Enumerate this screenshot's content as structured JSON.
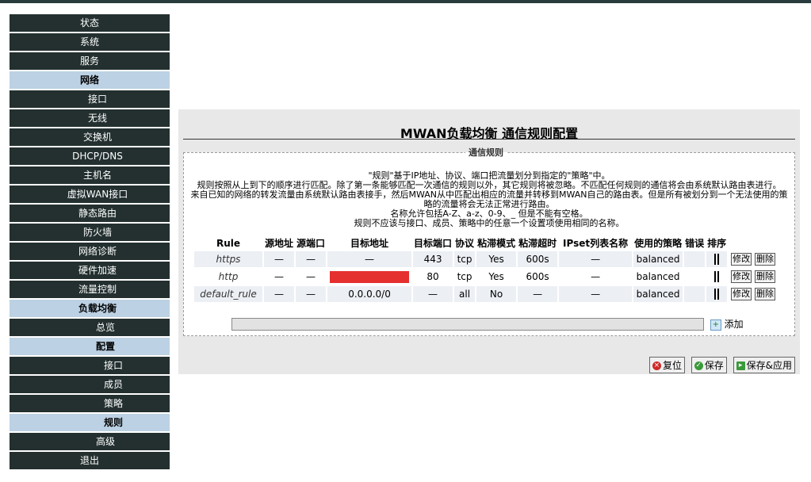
{
  "sidebar": {
    "items": [
      {
        "label": "状态"
      },
      {
        "label": "系统"
      },
      {
        "label": "服务"
      },
      {
        "label": "网络"
      },
      {
        "label": "接口"
      },
      {
        "label": "无线"
      },
      {
        "label": "交换机"
      },
      {
        "label": "DHCP/DNS"
      },
      {
        "label": "主机名"
      },
      {
        "label": "虚拟WAN接口"
      },
      {
        "label": "静态路由"
      },
      {
        "label": "防火墙"
      },
      {
        "label": "网络诊断"
      },
      {
        "label": "硬件加速"
      },
      {
        "label": "流量控制"
      },
      {
        "label": "负载均衡"
      },
      {
        "label": "总览"
      },
      {
        "label": "配置"
      },
      {
        "label": "接口"
      },
      {
        "label": "成员"
      },
      {
        "label": "策略"
      },
      {
        "label": "规则"
      },
      {
        "label": "高级"
      },
      {
        "label": "退出"
      }
    ]
  },
  "page": {
    "title": "MWAN负载均衡 通信规则配置",
    "section_legend": "通信规则",
    "description": [
      "\"规则\"基于IP地址、协议、端口把流量划分到指定的\"策略\"中。",
      "规则按照从上到下的顺序进行匹配。除了第一条能够匹配一次通信的规则以外，其它规则将被忽略。不匹配任何规则的通信将会由系统默认路由表进行。",
      "来自已知的网络的转发流量由系统默认路由表接手，然后MWAN从中匹配出相应的流量并转移到MWAN自己的路由表。但是所有被划分到一个无法使用的策略的流量将会无法正常进行路由。",
      "名称允许包括A-Z、a-z、0-9、_ 但是不能有空格。",
      "规则不应该与接口、成员、策略中的任意一个设置项使用相同的名称。"
    ]
  },
  "table": {
    "headers": [
      "Rule",
      "源地址",
      "源端口",
      "目标地址",
      "目标端口",
      "协议",
      "粘滞模式",
      "粘滞超时",
      "IPset列表名称",
      "使用的策略",
      "错误",
      "排序"
    ],
    "rows": [
      {
        "rule": "https",
        "src": "—",
        "sport": "—",
        "dest": "—",
        "dport": "443",
        "proto": "tcp",
        "sticky": "Yes",
        "timeout": "600s",
        "ipset": "—",
        "policy": "balanced",
        "error": "",
        "edit": "修改",
        "delete": "删除"
      },
      {
        "rule": "http",
        "src": "—",
        "sport": "—",
        "dest": "",
        "dport": "80",
        "proto": "tcp",
        "sticky": "Yes",
        "timeout": "600s",
        "ipset": "—",
        "policy": "balanced",
        "error": "",
        "edit": "修改",
        "delete": "删除"
      },
      {
        "rule": "default_rule",
        "src": "—",
        "sport": "—",
        "dest": "0.0.0.0/0",
        "dport": "—",
        "proto": "all",
        "sticky": "No",
        "timeout": "—",
        "ipset": "—",
        "policy": "balanced",
        "error": "",
        "edit": "修改",
        "delete": "删除"
      }
    ],
    "add_label": "添加",
    "add_input_value": ""
  },
  "actions": {
    "reset": "复位",
    "save": "保存",
    "save_apply": "保存&应用"
  }
}
